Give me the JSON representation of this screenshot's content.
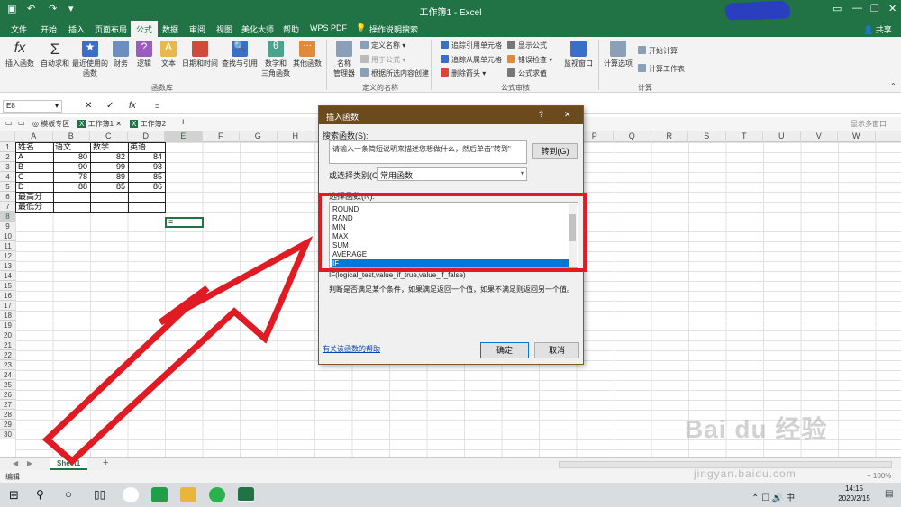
{
  "window": {
    "title": "工作簿1 - Excel",
    "share": "共享"
  },
  "tabs": [
    "文件",
    "开始",
    "插入",
    "页面布局",
    "公式",
    "数据",
    "审阅",
    "视图",
    "美化大师",
    "帮助",
    "WPS PDF",
    "操作说明搜索"
  ],
  "ribbon": {
    "insert_function": "插入函数",
    "autosum": "自动求和",
    "recent": "最近使用的",
    "recent2": "函数",
    "finance": "财务",
    "logic": "逻辑",
    "text": "文本",
    "datetime": "日期和时间",
    "lookup": "查找与引用",
    "math": "数学和",
    "math2": "三角函数",
    "other": "其他函数",
    "group_lib": "函数库",
    "name_mgr": "名称",
    "name_mgr2": "管理器",
    "define_name": "定义名称",
    "use_in_formula": "用于公式",
    "create_from_sel": "根据所选内容创建",
    "group_names": "定义的名称",
    "trace_prec": "追踪引用单元格",
    "trace_dep": "追踪从属单元格",
    "remove_arrows": "删除箭头",
    "show_formulas": "显示公式",
    "error_check": "错误检查",
    "eval_formula": "公式求值",
    "group_audit": "公式审核",
    "watch": "监视窗口",
    "calc_options": "计算选项",
    "calc_now": "开始计算",
    "calc_sheet": "计算工作表",
    "group_calc": "计算"
  },
  "formula_bar": {
    "name_box": "E8",
    "formula": "="
  },
  "file_tabs": {
    "template": "模板专区",
    "book1": "工作簿1",
    "book2": "工作簿2",
    "plus": "+",
    "right": "显示多窗口"
  },
  "columns": [
    "A",
    "B",
    "C",
    "D",
    "E",
    "F",
    "G",
    "H",
    "I",
    "J",
    "K",
    "L",
    "M",
    "N",
    "O",
    "P",
    "Q",
    "R",
    "S",
    "T",
    "U",
    "V",
    "W"
  ],
  "rows": [
    "1",
    "2",
    "3",
    "4",
    "5",
    "6",
    "7",
    "8",
    "9",
    "10",
    "11",
    "12",
    "13",
    "14",
    "15",
    "16",
    "17",
    "18",
    "19",
    "20",
    "21",
    "22",
    "23",
    "24",
    "25",
    "26",
    "27",
    "28",
    "29",
    "30"
  ],
  "table": [
    [
      "姓名",
      "语文",
      "数学",
      "英语"
    ],
    [
      "A",
      "80",
      "82",
      "84"
    ],
    [
      "B",
      "90",
      "99",
      "98"
    ],
    [
      "C",
      "78",
      "89",
      "85"
    ],
    [
      "D",
      "88",
      "85",
      "86"
    ],
    [
      "最高分",
      "",
      "",
      ""
    ],
    [
      "最低分",
      "",
      "",
      ""
    ]
  ],
  "e8": "=",
  "sheet": {
    "name": "Sheet1",
    "add": "+"
  },
  "status": {
    "mode": "编辑",
    "zoom": "100%"
  },
  "clock": {
    "time": "14:15",
    "date": "2020/2/15"
  },
  "dialog": {
    "title": "插入函数",
    "help": "?",
    "close": "✕",
    "search_label": "搜索函数(S):",
    "search_text": "请输入一条简短说明来描述您想做什么，然后单击\"转到\"",
    "goto": "转到(G)",
    "category_label": "或选择类别(C):",
    "category": "常用函数",
    "select_label": "选择函数(N):",
    "functions": [
      "ROUND",
      "RAND",
      "MIN",
      "MAX",
      "SUM",
      "AVERAGE",
      "IF"
    ],
    "signature": "IF(logical_test,value_if_true,value_if_false)",
    "description": "判断是否满足某个条件，如果满足返回一个值，如果不满足则返回另一个值。",
    "help_link": "有关该函数的帮助",
    "ok": "确定",
    "cancel": "取消"
  },
  "watermark": {
    "brand": "Bai du 经验",
    "url": "jingyan.baidu.com"
  },
  "colors": {
    "excel_green": "#217346",
    "dialog_title": "#6b4a1e",
    "highlight": "#e01b24",
    "selected": "#0078d7"
  }
}
